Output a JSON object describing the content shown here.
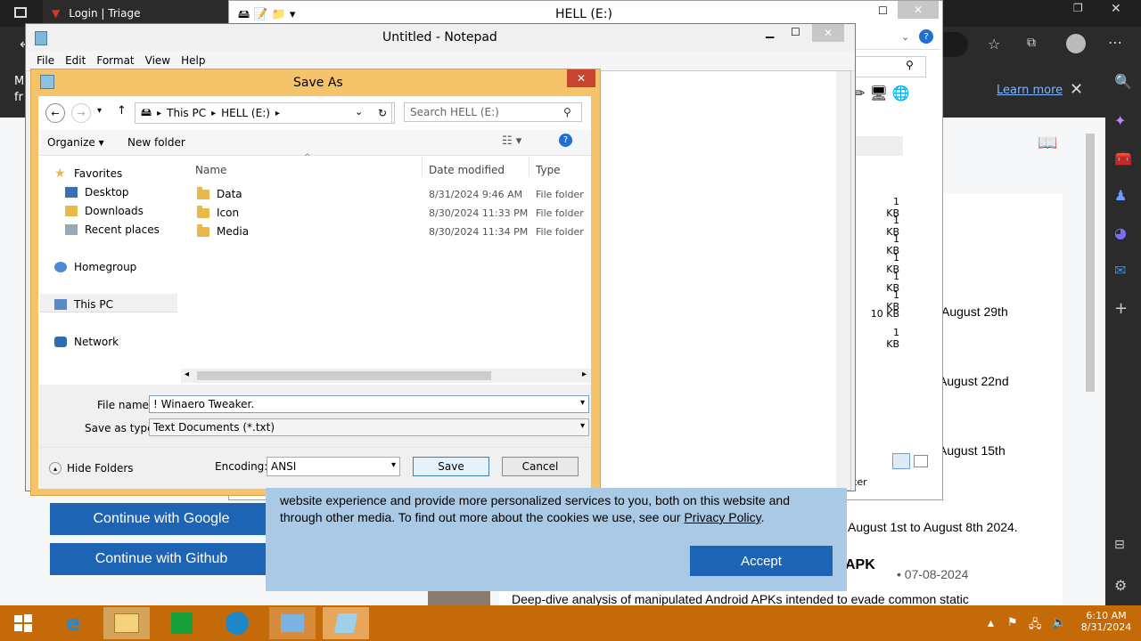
{
  "browser": {
    "tab_title": "Login | Triage",
    "banner_text_1": "M",
    "banner_text_2": "fr",
    "learn_more": "Learn more",
    "continue_google": "Continue with Google",
    "continue_github": "Continue with Github",
    "dates": [
      "August 29th",
      "August 22nd",
      "August 15th",
      "August 1st to August 8th 2024."
    ],
    "apk_title": "APK",
    "apk_date": "• 07-08-2024",
    "apk_desc": "Deep-dive analysis of manipulated Android APKs intended to evade common static"
  },
  "explorer": {
    "title": "HELL (E:)",
    "sizes": [
      "1 KB",
      "1 KB",
      "1 KB",
      "1 KB",
      "1 KB",
      "1 KB",
      "10 KB",
      "1 KB"
    ],
    "status_fragment": "ter",
    "col_fragment": "e"
  },
  "notepad": {
    "title": "Untitled - Notepad",
    "menu": [
      "File",
      "Edit",
      "Format",
      "View",
      "Help"
    ]
  },
  "dialog": {
    "title": "Save As",
    "breadcrumb": [
      "This PC",
      "HELL (E:)"
    ],
    "search_placeholder": "Search HELL (E:)",
    "organize": "Organize ▾",
    "new_folder": "New folder",
    "nav": {
      "favorites": "Favorites",
      "desktop": "Desktop",
      "downloads": "Downloads",
      "recent": "Recent places",
      "homegroup": "Homegroup",
      "thispc": "This PC",
      "network": "Network"
    },
    "columns": {
      "name": "Name",
      "date": "Date modified",
      "type": "Type"
    },
    "files": [
      {
        "name": "Data",
        "date": "8/31/2024 9:46 AM",
        "type": "File folder"
      },
      {
        "name": "Icon",
        "date": "8/30/2024 11:33 PM",
        "type": "File folder"
      },
      {
        "name": "Media",
        "date": "8/30/2024 11:34 PM",
        "type": "File folder"
      }
    ],
    "file_name_label": "File name:",
    "file_name_value": "! Winaero Tweaker.",
    "save_type_label": "Save as type:",
    "save_type_value": "Text Documents (*.txt)",
    "hide_folders": "Hide Folders",
    "encoding_label": "Encoding:",
    "encoding_value": "ANSI",
    "save": "Save",
    "cancel": "Cancel"
  },
  "cookie": {
    "line1": "website experience and provide more personalized services to you, both on this website and",
    "line2": "through other media. To find out more about the cookies we use, see our",
    "link": "Privacy Policy",
    "period": ".",
    "accept": "Accept"
  },
  "taskbar": {
    "time": "6:10 AM",
    "date": "8/31/2024"
  },
  "colors": {
    "taskbar": "#c56a09",
    "dialog_frame": "#f4c36a",
    "accent": "#1e64b5"
  }
}
